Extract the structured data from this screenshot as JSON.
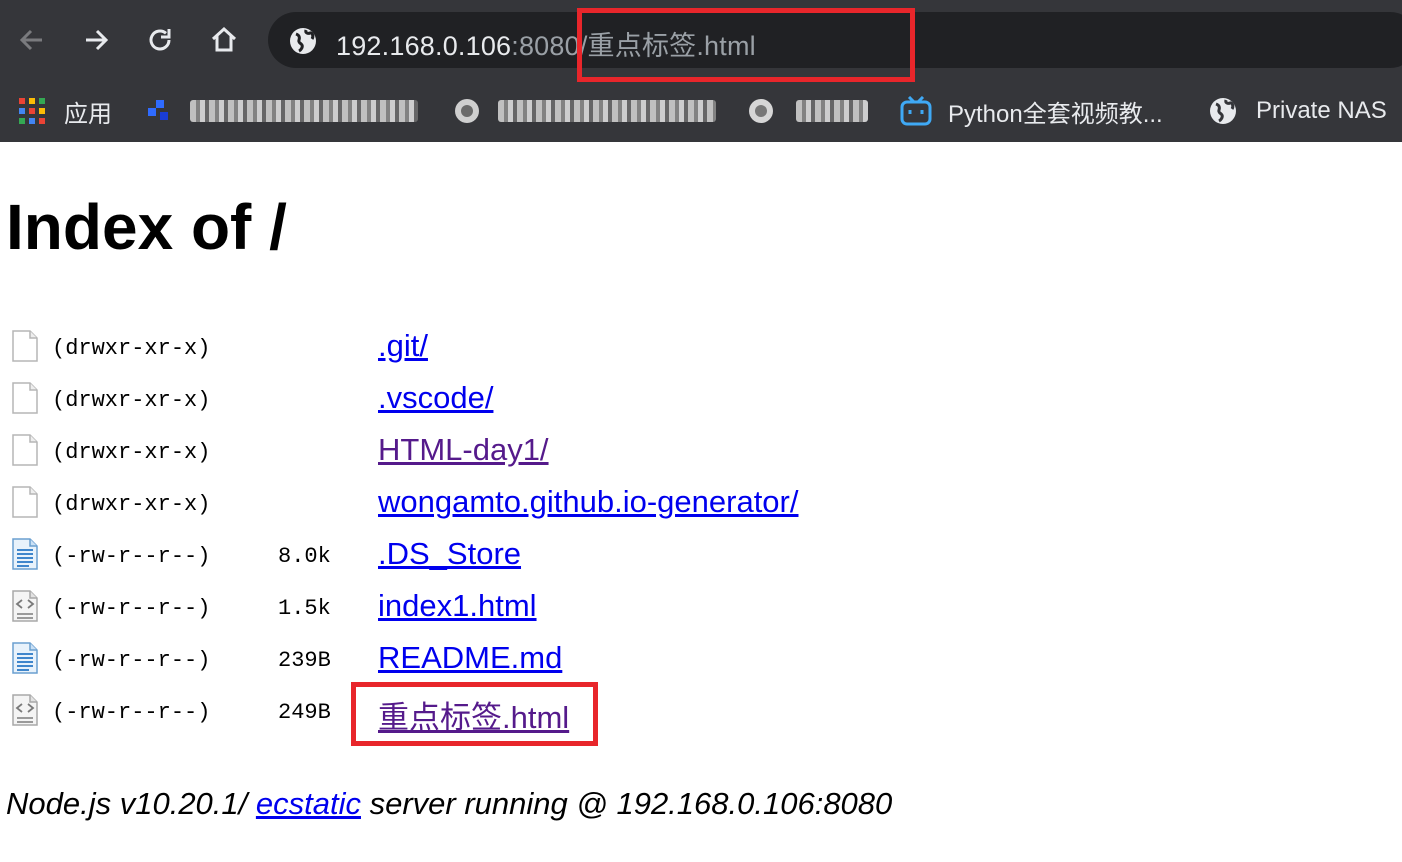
{
  "browser": {
    "url": {
      "host": "192.168.0.106",
      "port": ":8080",
      "path": "/重点标签.html"
    },
    "bookmarks": [
      {
        "icon": "apps-grid-icon",
        "label": "应用"
      },
      {
        "icon": "site-icon",
        "label": ""
      },
      {
        "icon": "globe-icon",
        "label": ""
      },
      {
        "icon": "globe-icon",
        "label": ""
      },
      {
        "icon": "bilibili-icon",
        "label": "Python全套视频教..."
      },
      {
        "icon": "globe-icon",
        "label": "Private NAS"
      }
    ]
  },
  "page": {
    "title": "Index of /",
    "entries": [
      {
        "icon": "blank-file-icon",
        "perm": "(drwxr-xr-x)",
        "size": "",
        "name": ".git/",
        "visited": false
      },
      {
        "icon": "blank-file-icon",
        "perm": "(drwxr-xr-x)",
        "size": "",
        "name": ".vscode/",
        "visited": false
      },
      {
        "icon": "blank-file-icon",
        "perm": "(drwxr-xr-x)",
        "size": "",
        "name": "HTML-day1/",
        "visited": true
      },
      {
        "icon": "blank-file-icon",
        "perm": "(drwxr-xr-x)",
        "size": "",
        "name": "wongamto.github.io-generator/",
        "visited": false
      },
      {
        "icon": "text-file-icon",
        "perm": "(-rw-r--r--)",
        "size": "8.0k",
        "name": ".DS_Store",
        "visited": false
      },
      {
        "icon": "html-file-icon",
        "perm": "(-rw-r--r--)",
        "size": "1.5k",
        "name": "index1.html",
        "visited": false
      },
      {
        "icon": "text-file-icon",
        "perm": "(-rw-r--r--)",
        "size": "239B",
        "name": "README.md",
        "visited": false
      },
      {
        "icon": "html-file-icon",
        "perm": "(-rw-r--r--)",
        "size": "249B",
        "name": "重点标签.html",
        "visited": true
      }
    ],
    "footer": {
      "prefix": "Node.js v10.20.1/ ",
      "link": "ecstatic",
      "suffix": " server running @ 192.168.0.106:8080"
    }
  },
  "colors": {
    "highlight": "#e8262b",
    "link": "#0000ee",
    "visited": "#551a8b"
  }
}
